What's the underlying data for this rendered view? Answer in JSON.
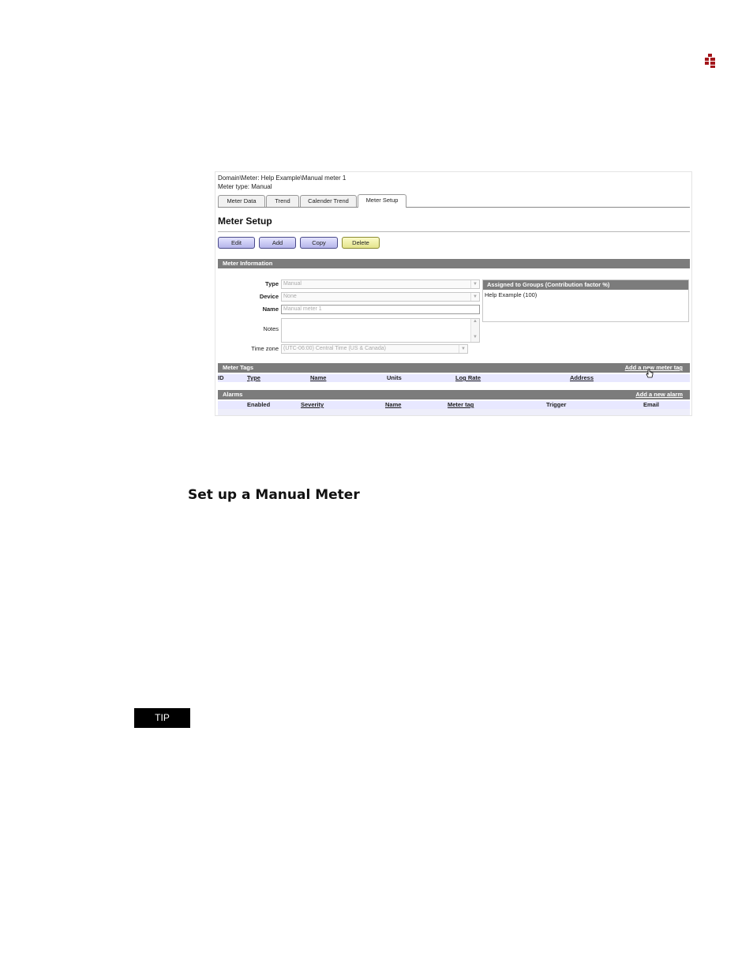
{
  "screenshot": {
    "breadcrumb": "Domain\\Meter: Help Example\\Manual meter 1",
    "meter_type": "Meter type: Manual",
    "tabs": [
      {
        "label": "Meter Data"
      },
      {
        "label": "Trend"
      },
      {
        "label": "Calender Trend"
      },
      {
        "label": "Meter Setup",
        "active": true
      }
    ],
    "title": "Meter Setup",
    "buttons": {
      "edit": "Edit",
      "add": "Add",
      "copy": "Copy",
      "delete": "Delete"
    },
    "meter_info": {
      "header": "Meter Information",
      "type_label": "Type",
      "type_value": "Manual",
      "device_label": "Device",
      "device_value": "None",
      "name_label": "Name",
      "name_value": "Manual meter 1",
      "notes_label": "Notes",
      "timezone_label": "Time zone",
      "timezone_value": "(UTC-06:00) Central Time (US & Canada)"
    },
    "groups": {
      "header": "Assigned to Groups (Contribution factor %)",
      "items": [
        "Help Example (100)"
      ]
    },
    "meter_tags": {
      "header": "Meter Tags",
      "add_link": "Add a new meter tag",
      "columns": [
        "ID",
        "Type",
        "Name",
        "Units",
        "Log Rate",
        "Address"
      ]
    },
    "alarms": {
      "header": "Alarms",
      "add_link": "Add a new alarm",
      "columns": [
        "Enabled",
        "Severity",
        "Name",
        "Meter tag",
        "Trigger",
        "Email"
      ]
    }
  },
  "document": {
    "section_heading": "Set up a Manual Meter",
    "tip_label": "TIP"
  },
  "colors": {
    "logo": "#a3161b",
    "header_bar": "#7c7c7c",
    "button_blue": "#b5b5ea",
    "button_yellow": "#e4e48c"
  }
}
